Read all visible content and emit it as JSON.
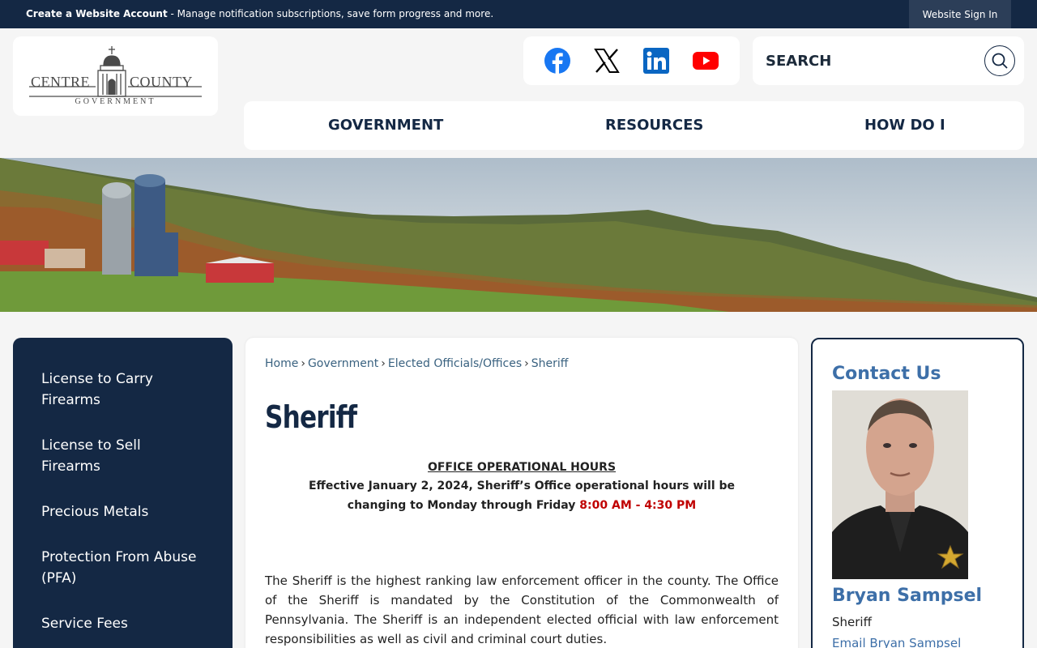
{
  "topbar": {
    "bold_text": "Create a Website Account",
    "text": " - Manage notification subscriptions, save form progress and more.",
    "signin_label": "Website Sign In"
  },
  "logo": {
    "left": "CENTRE",
    "right": "COUNTY",
    "sub": "GOVERNMENT"
  },
  "social": {
    "icons": [
      "facebook-icon",
      "x-icon",
      "linkedin-icon",
      "youtube-icon"
    ],
    "colors": {
      "facebook": "#1877f2",
      "x": "#000000",
      "linkedin": "#0a66c2",
      "youtube": "#ff0000"
    }
  },
  "search": {
    "placeholder": "SEARCH"
  },
  "nav": {
    "items": [
      {
        "label": "GOVERNMENT"
      },
      {
        "label": "RESOURCES"
      },
      {
        "label": "HOW DO I"
      }
    ]
  },
  "sidenav": {
    "items": [
      {
        "label": "License to Carry Firearms"
      },
      {
        "label": "License to Sell Firearms"
      },
      {
        "label": "Precious Metals"
      },
      {
        "label": "Protection From Abuse (PFA)"
      },
      {
        "label": "Service Fees"
      }
    ]
  },
  "breadcrumb": [
    "Home",
    "Government",
    "Elected Officials/Offices",
    "Sheriff"
  ],
  "main": {
    "title": "Sheriff",
    "hours_heading": "OFFICE OPERATIONAL HOURS",
    "hours_line1": "Effective January 2, 2024, Sheriff’s Office operational hours will be",
    "hours_line2_prefix": "changing to Monday through Friday ",
    "hours_line2_time": "8:00 AM - 4:30 PM",
    "body": "The Sheriff is the highest ranking law enforcement officer in the county. The Office of the Sheriff is mandated by the Constitution of the Commonwealth of Pennsylvania. The Sheriff is an independent elected official with law enforcement responsibilities as well as civil and criminal court duties."
  },
  "contact": {
    "title": "Contact Us",
    "name": "Bryan Sampsel",
    "role": "Sheriff",
    "email_label": "Email Bryan Sampsel"
  },
  "colors": {
    "navy": "#142844",
    "accent_blue": "#3d6fa8",
    "hours_red": "#c00000"
  }
}
